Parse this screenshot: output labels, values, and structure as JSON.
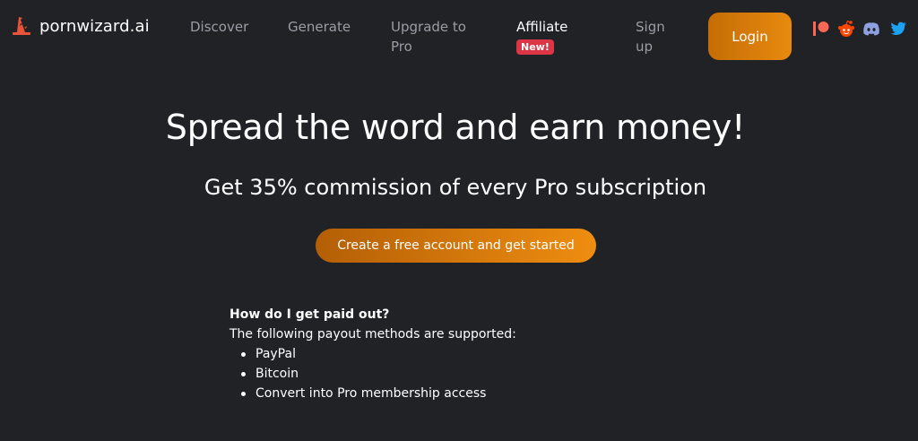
{
  "brand": {
    "name": "pornwizard.ai",
    "icon": "wizard-hat-icon",
    "color": "#e8533a"
  },
  "nav": {
    "discover": "Discover",
    "generate": "Generate",
    "upgrade": "Upgrade to Pro",
    "affiliate": "Affiliate",
    "affiliate_badge": "New!",
    "signup": "Sign up",
    "login": "Login"
  },
  "social": [
    {
      "name": "patreon-icon",
      "color": "#f96854"
    },
    {
      "name": "reddit-icon",
      "color": "#ff4500"
    },
    {
      "name": "discord-icon",
      "color": "#8ea1e1"
    },
    {
      "name": "twitter-icon",
      "color": "#1da1f2"
    }
  ],
  "hero": {
    "title": "Spread the word and earn money!",
    "subtitle": "Get 35% commission of every Pro subscription",
    "cta": "Create a free account and get started"
  },
  "faq": {
    "question": "How do I get paid out?",
    "answer": "The following payout methods are supported:",
    "methods": [
      "PayPal",
      "Bitcoin",
      "Convert into Pro membership access"
    ]
  },
  "colors": {
    "background": "#212226",
    "accent_start": "#c56d05",
    "accent_end": "#e88a0f",
    "badge": "#dc3545",
    "nav_muted": "#9a9da5"
  }
}
